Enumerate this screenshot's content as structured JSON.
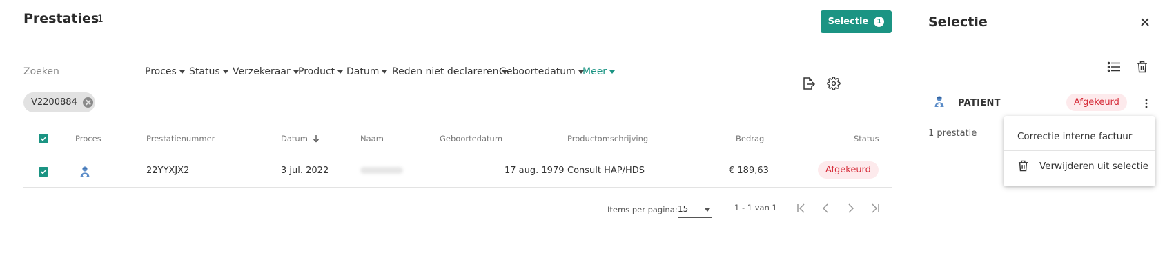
{
  "header": {
    "title": "Prestaties",
    "count": "1",
    "selection_button": {
      "label": "Selectie",
      "badge": "1"
    }
  },
  "search": {
    "placeholder": "Zoeken"
  },
  "filters": [
    "Proces",
    "Status",
    "Verzekeraar",
    "Product",
    "Datum",
    "Reden niet declareren",
    "Geboortedatum",
    "Meer"
  ],
  "active_filters": [
    "V2200884"
  ],
  "table": {
    "columns": [
      "Proces",
      "Prestatienummer",
      "Datum",
      "Naam",
      "Geboortedatum",
      "Productomschrijving",
      "Bedrag",
      "Status"
    ],
    "sorted_column": "Datum",
    "rows": [
      {
        "checked": true,
        "proces_icon": "patient-icon",
        "prestatienummer": "22YYXJX2",
        "datum": "3 jul. 2022",
        "naam": "Bridgeport",
        "geboortedatum": "17 aug. 1979",
        "productomschrijving": "Consult HAP/HDS",
        "bedrag": "€ 189,63",
        "status": "Afgekeurd"
      }
    ]
  },
  "pagination": {
    "items_per_page_label": "Items per pagina:",
    "items_per_page": "15",
    "range": "1 - 1 van 1"
  },
  "panel": {
    "title": "Selectie",
    "group_label": "PATIENT",
    "group_status": "Afgekeurd",
    "count_text": "1 prestatie",
    "menu": {
      "items": [
        "Correctie interne factuur",
        "Verwijderen uit selectie"
      ]
    }
  },
  "colors": {
    "accent": "#1b9483",
    "rejected_text": "#d62d3a",
    "rejected_bg": "#fdeaec"
  }
}
